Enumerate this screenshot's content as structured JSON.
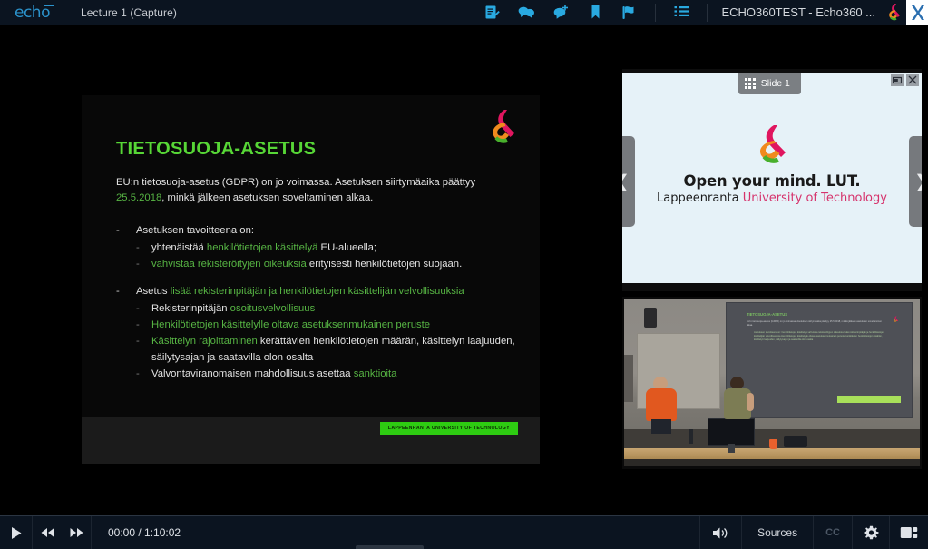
{
  "topbar": {
    "logo_text": "echo",
    "lecture_title": "Lecture 1 (Capture)",
    "course_title": "ECHO360TEST - Echo360 ...",
    "icons": [
      {
        "name": "notes-icon",
        "label": "Notes"
      },
      {
        "name": "discussions-icon",
        "label": "Discussions"
      },
      {
        "name": "add-question-icon",
        "label": "Ask a question"
      },
      {
        "name": "bookmark-icon",
        "label": "Bookmark"
      },
      {
        "name": "flag-icon",
        "label": "Flag as confusing"
      },
      {
        "name": "class-list-icon",
        "label": "Class list"
      }
    ]
  },
  "slide": {
    "title": "TIETOSUOJA-ASETUS",
    "paragraph_pre": "EU:n tietosuoja-asetus (GDPR) on jo voimassa. Asetuksen siirtymäaika päättyy ",
    "paragraph_date": "25.5.2018",
    "paragraph_post": ", minkä jälkeen asetuksen soveltaminen alkaa.",
    "bullet1": "Asetuksen tavoitteena on:",
    "sub1a_pre": "yhtenäistää ",
    "sub1a_hl": "henkilötietojen käsittelyä",
    "sub1a_post": " EU-alueella;",
    "sub1b_hl": "vahvistaa rekisteröityjen oikeuksia",
    "sub1b_post": " erityisesti henkilötietojen suojaan.",
    "bullet2_pre": "Asetus ",
    "bullet2_hl": "lisää rekisterinpitäjän ja henkilötietojen käsittelijän velvollisuuksia",
    "sub2a_pre": "Rekisterinpitäjän ",
    "sub2a_hl": "osoitusvelvollisuus",
    "sub2b_hl": "Henkilötietojen käsittelylle oltava asetuksenmukainen peruste",
    "sub2c_hl": "Käsittelyn rajoittaminen",
    "sub2c_post": " kerättävien henkilötietojen määrän, käsittelyn laajuuden, säilytysajan ja saatavilla olon osalta",
    "sub2d_pre": "Valvontaviranomaisen mahdollisuus asettaa ",
    "sub2d_hl": "sanktioita",
    "footer_badge": "LAPPEENRANTA UNIVERSITY OF TECHNOLOGY"
  },
  "thumbnail_panel": {
    "slide_label": "Slide 1",
    "prev_arrow": "❮",
    "next_arrow": "❯",
    "lut_line1": "Open your mind. LUT.",
    "lut_line2_black": "Lappeenranta ",
    "lut_line2_pink": "University of Technology"
  },
  "player": {
    "play_label": "▶",
    "rewind_label": "◀◀",
    "forward_label": "▶▶",
    "time": "00:00 / 1:10:02",
    "sources_label": "Sources",
    "cc_label": "CC"
  },
  "colors": {
    "accent_blue": "#2b93cc",
    "slide_green": "#57d636",
    "highlight_green": "#57b544",
    "badge_green": "#2ecc12",
    "lut_pink": "#d6336c",
    "topbar_bg": "#0b1420",
    "player_bg": "#0b1420"
  }
}
